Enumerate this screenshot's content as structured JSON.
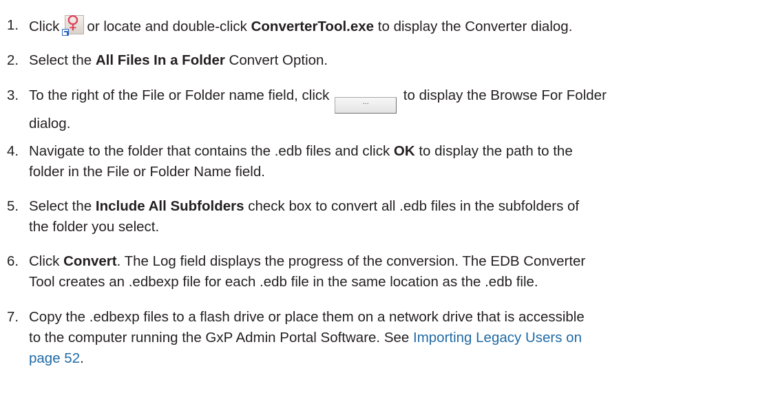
{
  "steps": [
    {
      "number": "1.",
      "parts": {
        "a": "Click",
        "icon": "converter-tool-app-icon",
        "b": "or locate and double-click",
        "c": "ConverterTool.exe",
        "d": "to display the Converter dialog."
      }
    },
    {
      "number": "2.",
      "parts": {
        "a": "Select the",
        "b": "All Files In a Folder",
        "c": "Convert Option."
      }
    },
    {
      "number": "3.",
      "parts": {
        "a": "To the right of the File or Folder name field, click",
        "button_label": "...",
        "b": "to display the Browse For Folder",
        "c": "dialog."
      }
    },
    {
      "number": "4.",
      "parts": {
        "a": "Navigate to the folder that contains the .edb files and click",
        "b": "OK",
        "c": "to display the path to the",
        "d": "folder in the File or Folder Name field."
      }
    },
    {
      "number": "5.",
      "parts": {
        "a": "Select the",
        "b": "Include All Subfolders",
        "c": "check box to convert all .edb files in the subfolders of",
        "d": "the folder you select."
      }
    },
    {
      "number": "6.",
      "parts": {
        "a": "Click",
        "b": "Convert",
        "c": ". The Log field displays the progress of the conversion. The EDB Converter",
        "d": "Tool creates an .edbexp file for each .edb file in the same location as the .edb file."
      }
    },
    {
      "number": "7.",
      "parts": {
        "a": "Copy the .edbexp files to a flash drive or place them on a network drive that is accessible",
        "b": "to the computer running the GxP Admin Portal Software. See",
        "link1": "Importing Legacy Users on",
        "link2": "page 52",
        "c": "."
      }
    }
  ],
  "colors": {
    "text": "#231f20",
    "link": "#1f6aa5"
  }
}
